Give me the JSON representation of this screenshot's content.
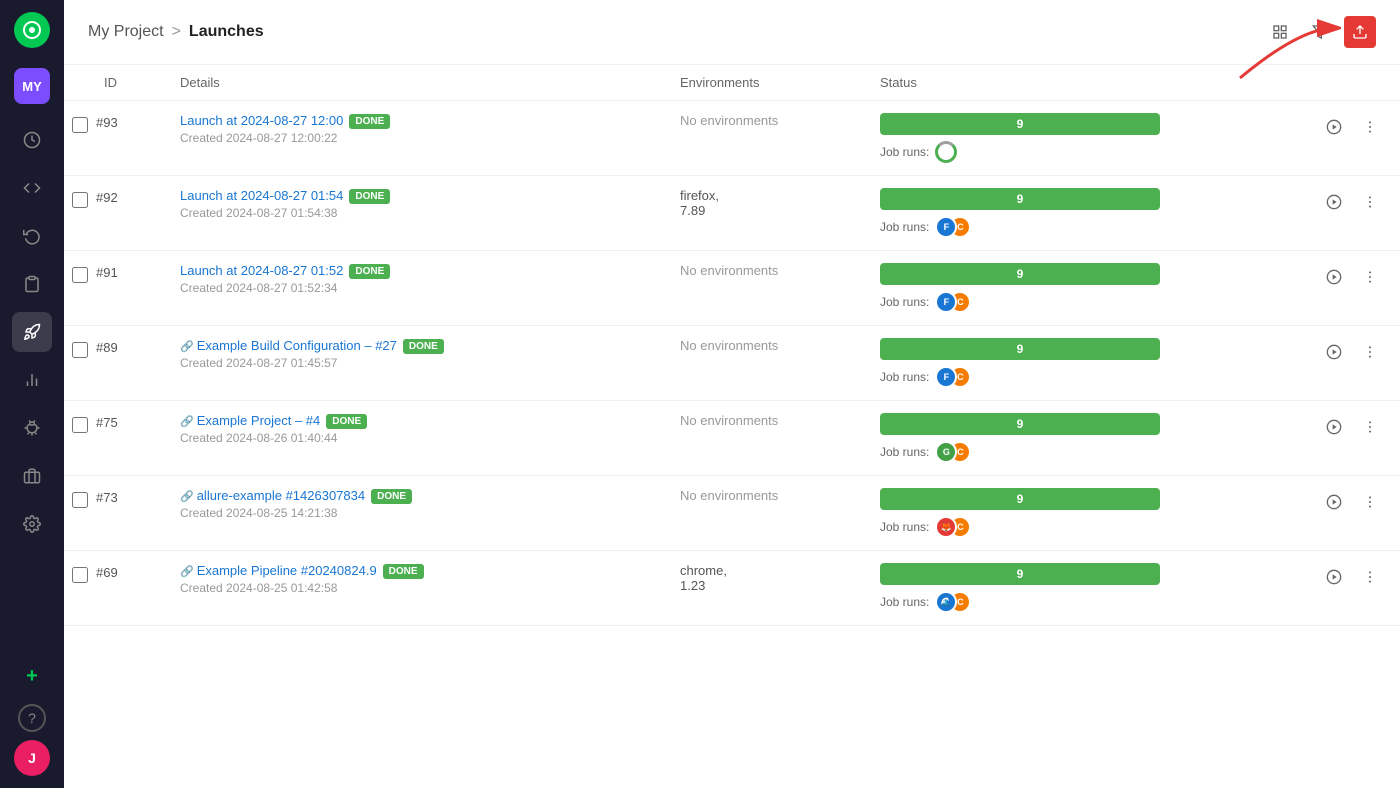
{
  "sidebar": {
    "logo_text": "◎",
    "project_avatar": "MY",
    "user_avatar": "J",
    "nav_items": [
      {
        "id": "dashboard",
        "icon": "clock",
        "active": false
      },
      {
        "id": "code",
        "icon": "code",
        "active": false
      },
      {
        "id": "refresh",
        "icon": "refresh",
        "active": false
      },
      {
        "id": "clipboard",
        "icon": "clipboard",
        "active": false
      },
      {
        "id": "launches",
        "icon": "rocket",
        "active": true
      },
      {
        "id": "chart",
        "icon": "chart",
        "active": false
      },
      {
        "id": "bug",
        "icon": "bug",
        "active": false
      },
      {
        "id": "storage",
        "icon": "storage",
        "active": false
      },
      {
        "id": "settings",
        "icon": "settings",
        "active": false
      }
    ],
    "add_icon": "+",
    "help_icon": "?"
  },
  "header": {
    "project": "My Project",
    "separator": ">",
    "current_page": "Launches",
    "btn_grid": "grid",
    "btn_filter": "filter",
    "btn_export": "export"
  },
  "table": {
    "columns": [
      "ID",
      "Details",
      "Environments",
      "Status"
    ],
    "rows": [
      {
        "id": "#93",
        "link_text": "Launch at 2024-08-27 12:00",
        "badge": "DONE",
        "created": "Created 2024-08-27 12:00:22",
        "env": "No environments",
        "progress_value": "9",
        "job_runs_label": "Job runs:",
        "has_link_icon": false
      },
      {
        "id": "#92",
        "link_text": "Launch at 2024-08-27 01:54",
        "badge": "DONE",
        "created": "Created 2024-08-27 01:54:38",
        "env": "firefox,\n7.89",
        "progress_value": "9",
        "job_runs_label": "Job runs:",
        "has_link_icon": false
      },
      {
        "id": "#91",
        "link_text": "Launch at 2024-08-27 01:52",
        "badge": "DONE",
        "created": "Created 2024-08-27 01:52:34",
        "env": "No environments",
        "progress_value": "9",
        "job_runs_label": "Job runs:",
        "has_link_icon": false
      },
      {
        "id": "#89",
        "link_text": "Example Build Configuration – #27",
        "badge": "DONE",
        "created": "Created 2024-08-27 01:45:57",
        "env": "No environments",
        "progress_value": "9",
        "job_runs_label": "Job runs:",
        "has_link_icon": true
      },
      {
        "id": "#75",
        "link_text": "Example Project – #4",
        "badge": "DONE",
        "created": "Created 2024-08-26 01:40:44",
        "env": "No environments",
        "progress_value": "9",
        "job_runs_label": "Job runs:",
        "has_link_icon": true
      },
      {
        "id": "#73",
        "link_text": "allure-example #1426307834",
        "badge": "DONE",
        "created": "Created 2024-08-25 14:21:38",
        "env": "No environments",
        "progress_value": "9",
        "job_runs_label": "Job runs:",
        "has_link_icon": true
      },
      {
        "id": "#69",
        "link_text": "Example Pipeline #20240824.9",
        "badge": "DONE",
        "created": "Created 2024-08-25 01:42:58",
        "env": "chrome,\n1.23",
        "progress_value": "9",
        "job_runs_label": "Job runs:",
        "has_link_icon": true
      }
    ]
  }
}
